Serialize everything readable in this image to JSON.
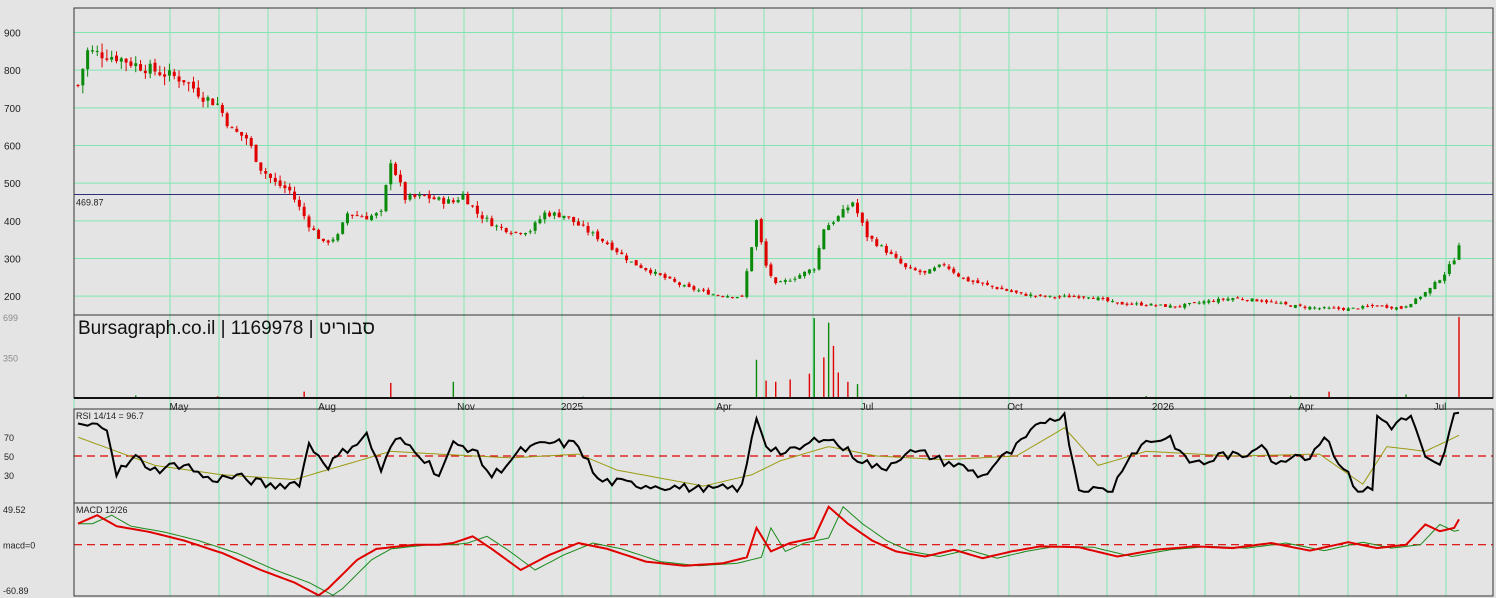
{
  "watermark": "Bursagraph.co.il | 1169978 | סבוריט",
  "colors": {
    "background": "#e4e4e4",
    "grid": "#7fe6b0",
    "up": "#0a8a0a",
    "down": "#e00000",
    "rsi_line": "#000000",
    "signal_line": "#9a9a10",
    "macd_line": "#e00000",
    "macd_signal": "#1a8a1a",
    "ref_line": "#2b2f7a",
    "dashed": "#e00000"
  },
  "chart_data": [
    {
      "type": "candlestick",
      "panel": "price",
      "y_ticks": [
        "900",
        "800",
        "700",
        "600",
        "500",
        "400",
        "300",
        "200"
      ],
      "ylim": [
        150,
        965
      ],
      "reference_line": {
        "value": 469.87,
        "label": "469.87"
      },
      "x_tick_labels": [
        "May",
        "Aug",
        "Nov",
        "2025",
        "Apr",
        "Jul",
        "Oct",
        "2026",
        "Apr",
        "Jul"
      ],
      "close_anchors": [
        [
          0,
          760
        ],
        [
          2,
          850
        ],
        [
          8,
          835
        ],
        [
          12,
          815
        ],
        [
          18,
          790
        ],
        [
          22,
          775
        ],
        [
          26,
          730
        ],
        [
          29,
          710
        ],
        [
          32,
          640
        ],
        [
          35,
          620
        ],
        [
          38,
          540
        ],
        [
          41,
          500
        ],
        [
          44,
          480
        ],
        [
          48,
          390
        ],
        [
          51,
          340
        ],
        [
          54,
          360
        ],
        [
          56,
          420
        ],
        [
          60,
          410
        ],
        [
          63,
          420
        ],
        [
          65,
          560
        ],
        [
          68,
          460
        ],
        [
          72,
          465
        ],
        [
          75,
          455
        ],
        [
          78,
          450
        ],
        [
          80,
          470
        ],
        [
          83,
          420
        ],
        [
          87,
          385
        ],
        [
          91,
          370
        ],
        [
          94,
          375
        ],
        [
          97,
          420
        ],
        [
          101,
          415
        ],
        [
          105,
          380
        ],
        [
          110,
          340
        ],
        [
          115,
          290
        ],
        [
          120,
          260
        ],
        [
          126,
          225
        ],
        [
          132,
          205
        ],
        [
          138,
          198
        ],
        [
          141,
          400
        ],
        [
          143,
          280
        ],
        [
          145,
          230
        ],
        [
          149,
          250
        ],
        [
          153,
          275
        ],
        [
          155,
          380
        ],
        [
          158,
          410
        ],
        [
          161,
          450
        ],
        [
          164,
          360
        ],
        [
          168,
          320
        ],
        [
          172,
          275
        ],
        [
          176,
          260
        ],
        [
          180,
          285
        ],
        [
          184,
          245
        ],
        [
          190,
          225
        ],
        [
          196,
          205
        ],
        [
          202,
          198
        ],
        [
          210,
          200
        ],
        [
          216,
          180
        ],
        [
          222,
          178
        ],
        [
          228,
          172
        ],
        [
          234,
          185
        ],
        [
          240,
          195
        ],
        [
          246,
          188
        ],
        [
          252,
          175
        ],
        [
          258,
          168
        ],
        [
          264,
          166
        ],
        [
          270,
          175
        ],
        [
          275,
          168
        ],
        [
          278,
          190
        ],
        [
          281,
          220
        ],
        [
          284,
          260
        ],
        [
          286,
          300
        ],
        [
          287,
          340
        ]
      ],
      "n_bars": 288
    },
    {
      "type": "bar",
      "panel": "volume",
      "y_ticks": [
        "699",
        "350"
      ],
      "ylim": [
        0,
        699
      ],
      "spikes": [
        [
          12,
          22
        ],
        [
          29,
          15
        ],
        [
          47,
          55
        ],
        [
          65,
          130
        ],
        [
          78,
          140
        ],
        [
          105,
          12
        ],
        [
          141,
          330
        ],
        [
          143,
          150
        ],
        [
          145,
          140
        ],
        [
          148,
          160
        ],
        [
          152,
          210
        ],
        [
          153,
          690
        ],
        [
          155,
          350
        ],
        [
          156,
          650
        ],
        [
          157,
          450
        ],
        [
          158,
          220
        ],
        [
          160,
          140
        ],
        [
          162,
          120
        ],
        [
          222,
          18
        ],
        [
          252,
          20
        ],
        [
          260,
          55
        ],
        [
          276,
          30
        ],
        [
          287,
          699
        ]
      ]
    },
    {
      "type": "line",
      "panel": "rsi",
      "label": "RSI 14/14 = 96.7",
      "y_ticks": [
        "70",
        "50",
        "30"
      ],
      "ylim": [
        0,
        100
      ],
      "dashed_level": 50,
      "anchors": [
        [
          0,
          82
        ],
        [
          6,
          82
        ],
        [
          8,
          32
        ],
        [
          12,
          48
        ],
        [
          16,
          35
        ],
        [
          22,
          42
        ],
        [
          27,
          25
        ],
        [
          33,
          28
        ],
        [
          40,
          18
        ],
        [
          46,
          22
        ],
        [
          48,
          62
        ],
        [
          52,
          40
        ],
        [
          56,
          58
        ],
        [
          60,
          72
        ],
        [
          63,
          35
        ],
        [
          66,
          68
        ],
        [
          70,
          58
        ],
        [
          75,
          30
        ],
        [
          78,
          62
        ],
        [
          82,
          58
        ],
        [
          86,
          28
        ],
        [
          92,
          55
        ],
        [
          98,
          64
        ],
        [
          104,
          62
        ],
        [
          108,
          24
        ],
        [
          115,
          20
        ],
        [
          122,
          18
        ],
        [
          130,
          14
        ],
        [
          138,
          16
        ],
        [
          141,
          92
        ],
        [
          143,
          62
        ],
        [
          147,
          52
        ],
        [
          151,
          60
        ],
        [
          155,
          72
        ],
        [
          158,
          62
        ],
        [
          162,
          48
        ],
        [
          167,
          35
        ],
        [
          172,
          54
        ],
        [
          176,
          52
        ],
        [
          180,
          44
        ],
        [
          184,
          38
        ],
        [
          188,
          28
        ],
        [
          191,
          44
        ],
        [
          194,
          54
        ],
        [
          198,
          74
        ],
        [
          201,
          88
        ],
        [
          203,
          92
        ],
        [
          205,
          92
        ],
        [
          208,
          14
        ],
        [
          215,
          14
        ],
        [
          218,
          48
        ],
        [
          222,
          65
        ],
        [
          227,
          70
        ],
        [
          230,
          46
        ],
        [
          234,
          42
        ],
        [
          238,
          52
        ],
        [
          242,
          48
        ],
        [
          246,
          66
        ],
        [
          249,
          38
        ],
        [
          252,
          52
        ],
        [
          256,
          50
        ],
        [
          259,
          72
        ],
        [
          263,
          36
        ],
        [
          266,
          14
        ],
        [
          269,
          14
        ],
        [
          270,
          92
        ],
        [
          273,
          82
        ],
        [
          277,
          92
        ],
        [
          280,
          46
        ],
        [
          283,
          38
        ],
        [
          286,
          92
        ],
        [
          287,
          94
        ]
      ],
      "signal_anchors": [
        [
          0,
          70
        ],
        [
          8,
          55
        ],
        [
          16,
          40
        ],
        [
          30,
          30
        ],
        [
          45,
          25
        ],
        [
          55,
          40
        ],
        [
          65,
          55
        ],
        [
          75,
          52
        ],
        [
          90,
          48
        ],
        [
          104,
          52
        ],
        [
          112,
          35
        ],
        [
          130,
          18
        ],
        [
          140,
          30
        ],
        [
          146,
          45
        ],
        [
          156,
          60
        ],
        [
          166,
          50
        ],
        [
          180,
          46
        ],
        [
          195,
          50
        ],
        [
          205,
          80
        ],
        [
          212,
          40
        ],
        [
          222,
          55
        ],
        [
          240,
          50
        ],
        [
          258,
          52
        ],
        [
          267,
          20
        ],
        [
          272,
          60
        ],
        [
          280,
          55
        ],
        [
          287,
          72
        ]
      ]
    },
    {
      "type": "line",
      "panel": "macd",
      "label": "MACD 12/26",
      "y_ticks": [
        "49.52",
        "macd=0",
        "-60.89"
      ],
      "ylim": [
        -60.89,
        49.52
      ],
      "dashed_level": 0,
      "anchors": [
        [
          0,
          25
        ],
        [
          4,
          35
        ],
        [
          8,
          22
        ],
        [
          15,
          15
        ],
        [
          22,
          5
        ],
        [
          30,
          -10
        ],
        [
          38,
          -30
        ],
        [
          45,
          -45
        ],
        [
          50,
          -60
        ],
        [
          52,
          -52
        ],
        [
          58,
          -18
        ],
        [
          62,
          -5
        ],
        [
          70,
          0
        ],
        [
          75,
          0
        ],
        [
          78,
          2
        ],
        [
          82,
          10
        ],
        [
          86,
          -5
        ],
        [
          92,
          -30
        ],
        [
          98,
          -12
        ],
        [
          104,
          2
        ],
        [
          110,
          -5
        ],
        [
          118,
          -20
        ],
        [
          126,
          -25
        ],
        [
          134,
          -22
        ],
        [
          139,
          -15
        ],
        [
          141,
          20
        ],
        [
          144,
          -8
        ],
        [
          148,
          2
        ],
        [
          153,
          8
        ],
        [
          156,
          45
        ],
        [
          160,
          25
        ],
        [
          165,
          5
        ],
        [
          170,
          -8
        ],
        [
          176,
          -14
        ],
        [
          182,
          -6
        ],
        [
          188,
          -16
        ],
        [
          194,
          -8
        ],
        [
          200,
          -2
        ],
        [
          208,
          -3
        ],
        [
          216,
          -14
        ],
        [
          224,
          -6
        ],
        [
          232,
          -2
        ],
        [
          240,
          -4
        ],
        [
          248,
          2
        ],
        [
          256,
          -7
        ],
        [
          264,
          3
        ],
        [
          270,
          -4
        ],
        [
          276,
          0
        ],
        [
          280,
          24
        ],
        [
          283,
          16
        ],
        [
          286,
          20
        ],
        [
          287,
          30
        ]
      ]
    }
  ]
}
